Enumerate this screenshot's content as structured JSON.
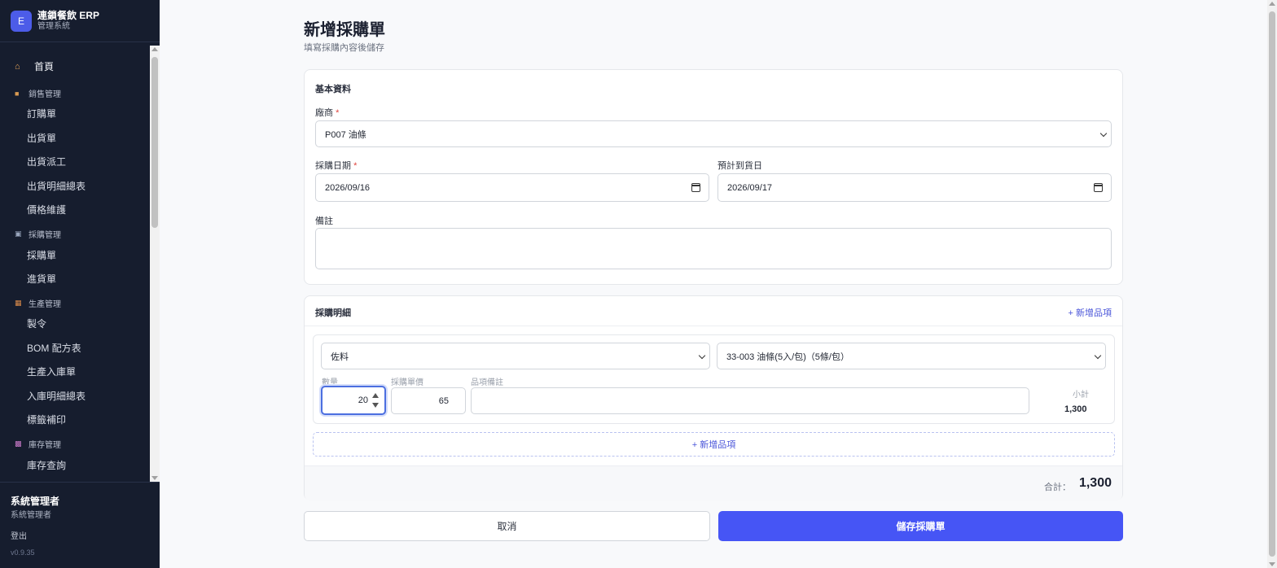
{
  "app": {
    "badge": "E",
    "title": "連鎖餐飲 ERP",
    "subtitle": "管理系統"
  },
  "nav": {
    "home": "首頁",
    "groups": {
      "sales": {
        "label": "銷售管理",
        "items": [
          "訂購單",
          "出貨單",
          "出貨派工",
          "出貨明細總表",
          "價格維護"
        ]
      },
      "purchase": {
        "label": "採購管理",
        "items": [
          "採購單",
          "進貨單"
        ]
      },
      "production": {
        "label": "生產管理",
        "items": [
          "製令",
          "BOM 配方表",
          "生產入庫單",
          "入庫明細總表",
          "標籤補印"
        ]
      },
      "inventory": {
        "label": "庫存管理",
        "items": [
          "庫存查詢"
        ]
      }
    }
  },
  "user": {
    "name": "系統管理者",
    "role": "系統管理者",
    "logout": "登出",
    "version": "v0.9.35"
  },
  "page": {
    "title": "新增採購單",
    "subtitle": "填寫採購內容後儲存"
  },
  "basic": {
    "title": "基本資料",
    "vendor_label": "廠商",
    "vendor_value": "P007 油條",
    "date_label": "採購日期",
    "date_value": "2026/09/16",
    "eta_label": "預計到貨日",
    "eta_value": "2026/09/17",
    "note_label": "備註",
    "note_value": ""
  },
  "detail": {
    "title": "採購明細",
    "add_link": "+ 新增品項",
    "add_button": "+ 新增品項",
    "item": {
      "category": "佐料",
      "product": "33-003 油條(5入/包)（5條/包）",
      "qty_label": "數量",
      "qty": "20",
      "price_label": "採購單價",
      "price": "65",
      "note_label": "品項備註",
      "note": "",
      "subtotal_label": "小計",
      "subtotal": "1,300"
    },
    "total_label": "合計：",
    "total": "1,300"
  },
  "actions": {
    "cancel": "取消",
    "save": "儲存採購單"
  }
}
